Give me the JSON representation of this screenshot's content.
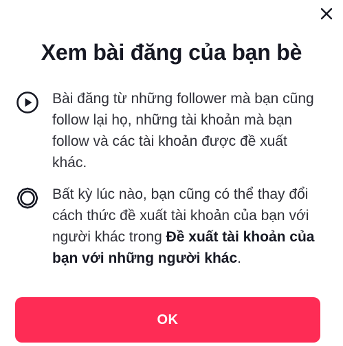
{
  "dialog": {
    "title": "Xem bài đăng của bạn bè",
    "close_icon": "close-icon",
    "items": [
      {
        "icon": "play-circle-icon",
        "text": "Bài đăng từ những follower mà bạn cũng follow lại họ, những tài khoản mà bạn follow và các tài khoản được đề xuất khác."
      },
      {
        "icon": "gear-icon",
        "text_before": "Bất kỳ lúc nào, bạn cũng có thể thay đổi cách thức đề xuất tài khoản của bạn với người khác trong ",
        "text_bold": "Đề xuất tài khoản của bạn với những người khác",
        "text_after": "."
      }
    ],
    "ok_label": "OK"
  },
  "colors": {
    "accent": "#fe2c55",
    "text_primary": "#161823",
    "text_secondary": "#2f3038",
    "background": "#ffffff"
  }
}
